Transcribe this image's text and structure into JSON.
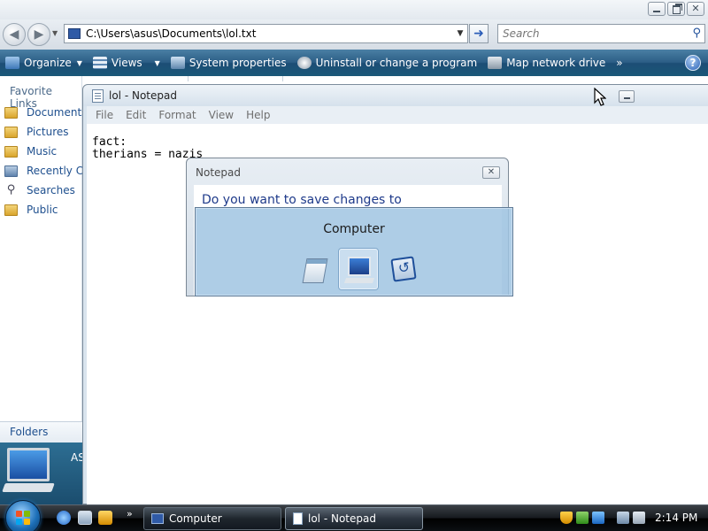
{
  "explorer": {
    "address": "C:\\Users\\asus\\Documents\\lol.txt",
    "search_placeholder": "Search",
    "toolbar": {
      "organize": "Organize",
      "views": "Views",
      "system_properties": "System properties",
      "uninstall": "Uninstall or change a program",
      "map_drive": "Map network drive",
      "more": "»"
    },
    "nav": {
      "heading": "Favorite Links",
      "items": [
        "Documents",
        "Pictures",
        "Music",
        "Recently Ch",
        "Searches",
        "Public"
      ],
      "folders_label": "Folders",
      "details_name": "AS"
    }
  },
  "notepad": {
    "title": "lol - Notepad",
    "menu": [
      "File",
      "Edit",
      "Format",
      "View",
      "Help"
    ],
    "content_line1": "fact:",
    "content_line2": "therians = nazis"
  },
  "dialog": {
    "title": "Notepad",
    "message": "Do you want to save changes to"
  },
  "switcher": {
    "title": "Computer",
    "icons": [
      "notepad-icon",
      "computer-icon",
      "flip3d-icon"
    ]
  },
  "taskbar": {
    "more": "»",
    "buttons": [
      "Computer",
      "lol - Notepad"
    ],
    "clock": "2:14 PM"
  },
  "colors": {
    "toolbar": "#2c5e86",
    "switcher": "#a0c4e2",
    "dialog_text": "#1e3a8a"
  }
}
